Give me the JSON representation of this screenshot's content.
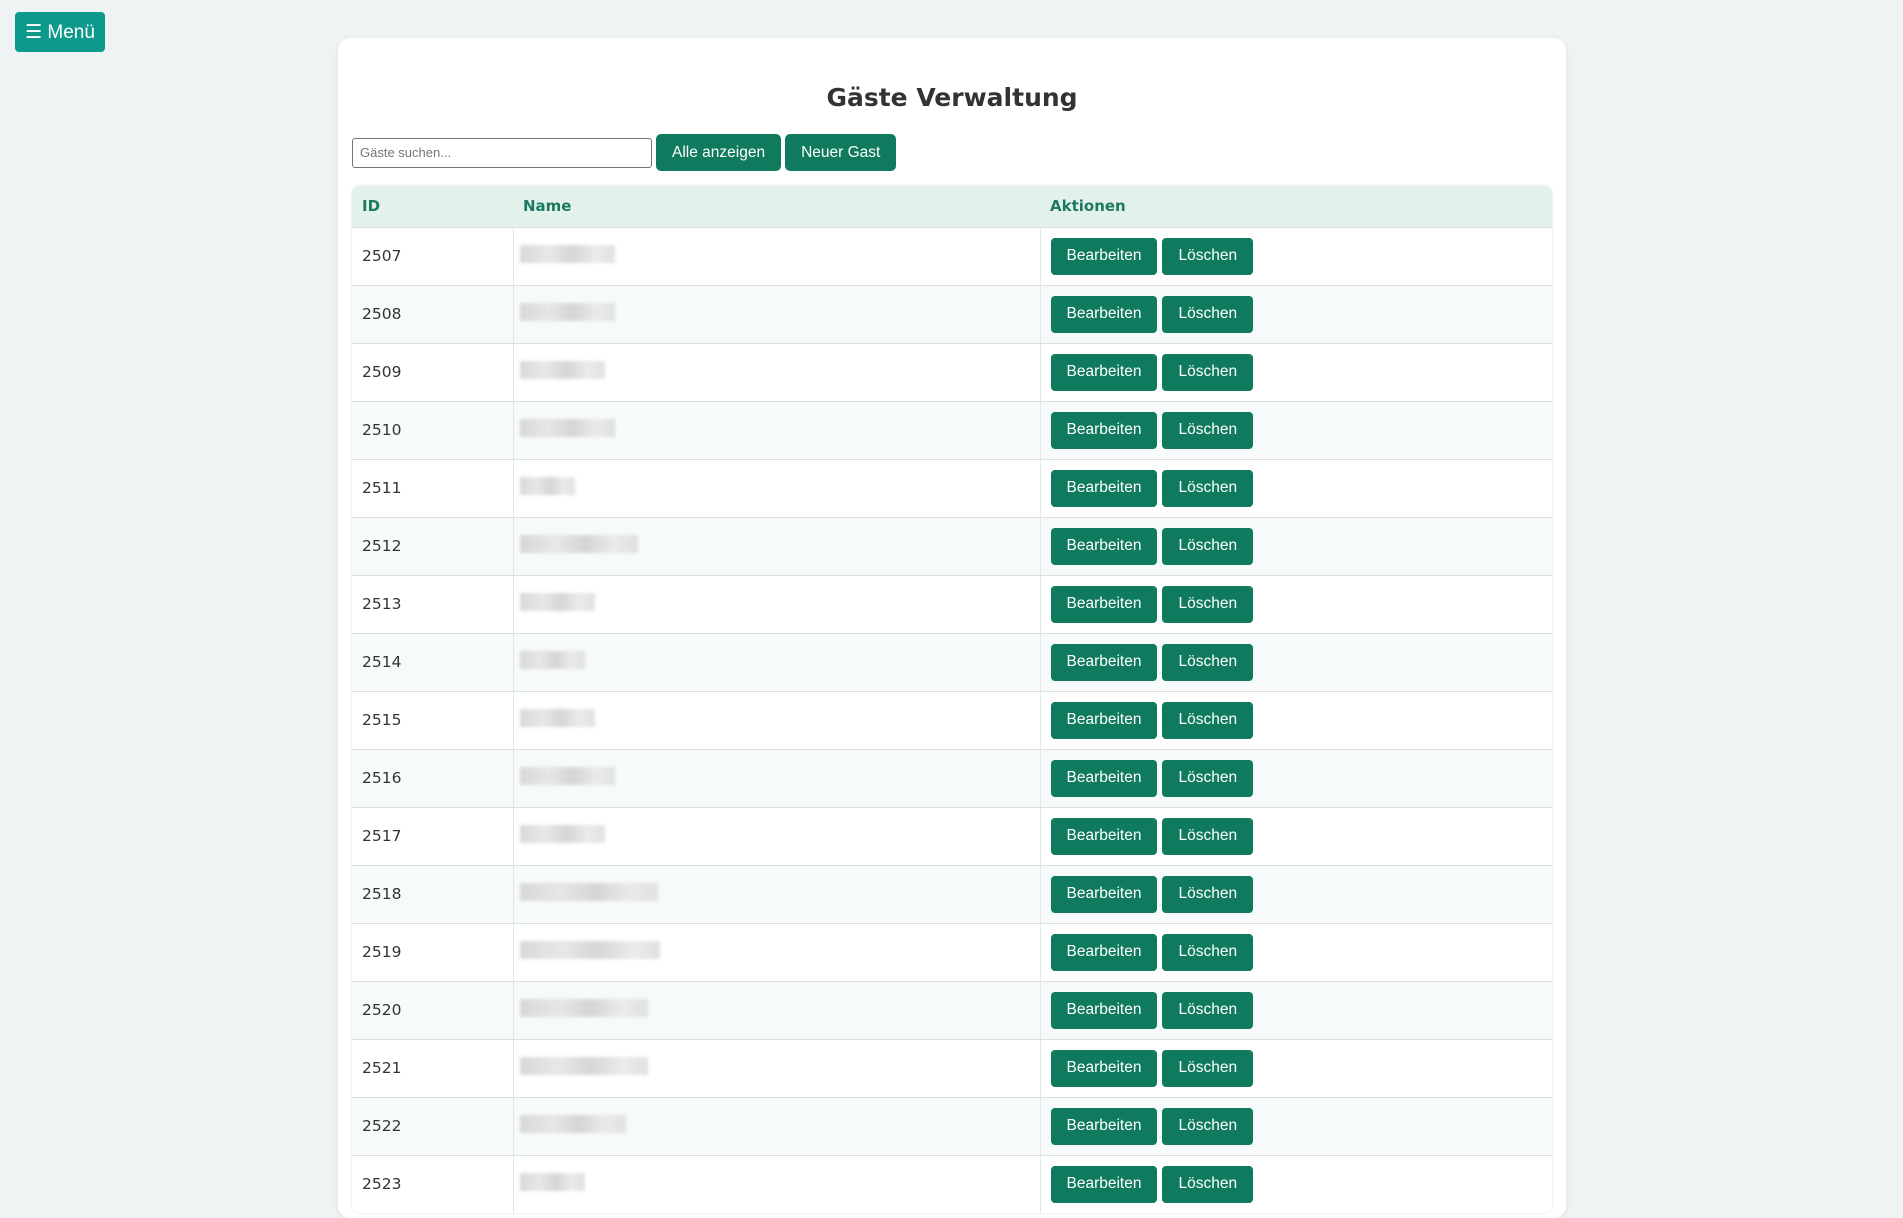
{
  "menu": {
    "label": "☰ Menü"
  },
  "page": {
    "title": "Gäste Verwaltung"
  },
  "toolbar": {
    "search_placeholder": "Gäste suchen...",
    "show_all_label": "Alle anzeigen",
    "new_guest_label": "Neuer Gast"
  },
  "table": {
    "headers": {
      "id": "ID",
      "name": "Name",
      "actions": "Aktionen"
    },
    "edit_label": "Bearbeiten",
    "delete_label": "Löschen",
    "rows": [
      {
        "id": "2507"
      },
      {
        "id": "2508"
      },
      {
        "id": "2509"
      },
      {
        "id": "2510"
      },
      {
        "id": "2511"
      },
      {
        "id": "2512"
      },
      {
        "id": "2513"
      },
      {
        "id": "2514"
      },
      {
        "id": "2515"
      },
      {
        "id": "2516"
      },
      {
        "id": "2517"
      },
      {
        "id": "2518"
      },
      {
        "id": "2519"
      },
      {
        "id": "2520"
      },
      {
        "id": "2521"
      },
      {
        "id": "2522"
      },
      {
        "id": "2523"
      }
    ]
  }
}
